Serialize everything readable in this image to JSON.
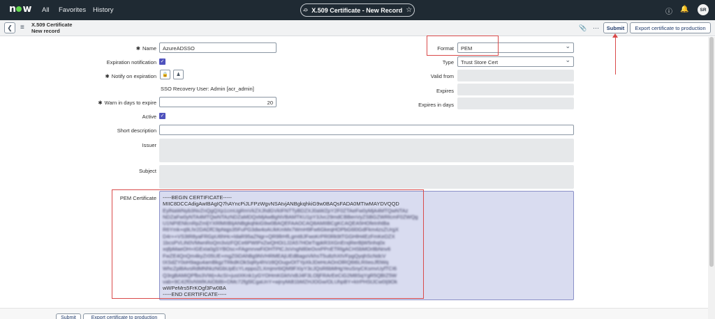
{
  "topnav": {
    "logo_left": "n",
    "logo_right": "w",
    "links": [
      "All",
      "Favorites",
      "History"
    ],
    "record_title": "X.509 Certificate - New Record",
    "star_icon": "star-icon",
    "help_icon": "help-icon",
    "bell_icon": "bell-icon",
    "avatar_initials": "SR"
  },
  "header": {
    "title": "X.509 Certificate",
    "subtitle": "New record",
    "submit_label": "Submit",
    "export_label": "Export certificate to production"
  },
  "form": {
    "name_label": "Name",
    "name_value": "AzureADSSO",
    "expiration_notification_label": "Expiration notification",
    "notify_label": "Notify on expiration",
    "notify_static": "SSO Recovery User: Admin [acr_admin]",
    "warn_label": "Warn in days to expire",
    "warn_value": "20",
    "active_label": "Active",
    "short_desc_label": "Short description",
    "short_desc_value": "",
    "issuer_label": "Issuer",
    "subject_label": "Subject",
    "pem_label": "PEM Certificate",
    "format_label": "Format",
    "format_value": "PEM",
    "type_label": "Type",
    "type_value": "Trust Store Cert",
    "valid_from_label": "Valid from",
    "expires_label": "Expires",
    "expires_in_days_label": "Expires in days",
    "pem_lines": [
      "-----BEGIN CERTIFICATE-----",
      "MIIC8DCCAdigAwIBAgIQ7hAYncPiJLFPzWgvNSAtvjANBgkqhkiG9w0BAQsFADA0MTIwMAYDVQQD",
      "EylNaWNyb3NvZnQgQXp1cmUgRmVkZXJhdGVkIFNTTyBDZXJ0aWZpY2F0ZTAeFw0yMjA4MTQwNTAz",
      "NDZaFw0yNTA4MTQwNTAzNDZaMDQxMjAwBgNVBAMTKU1pY3Jvc29mdCBBenVyZSBGZWRlcmF0ZWQg",
      "U1NPIENlcnRpZmljYXRlMIIBIjANBgkqhkiG9w0BAQEFAAOCAQ8AMIIBCgKCAQEA5HOfeInhtBa",
      "R6Ymk+q9Lhr2DADfC9pNqjs35FuPG3dw4oAUkKmMx7WmH9Fw6GkeqHOPbG6l0GdFkm4zsZUrgX",
      "D4r++VS3tR8yaFRGpU6hHc+ldaR95aZNgr+QR9llrHfLgmt8JFwoKrPR0Rk9tTGGHlH4EzFmKeDZX",
      "1bcsPVLiN0VMwnRoQm3vizFQCe6PWtPxZwQHOi1J2A57HOeTqpkR3XGnErxjRerBjW5nhq0x",
      "xqfpMaeOH+IGExIa0gSYBOsc+FAgmrvwFiOHTPtCJsVngNtl0eOvxPPnETRlgACHSbMOr8bNnv6",
      "FwZE4QnQm4kyZr05UE+mgZ0iDAhBg9NVHRMEAjUEdBagoVkhsT5u8zhXtVFpgQyqhScNdcV",
      "tXSdZY0oH9agu4amBkgzTRkdKOkSqRy4hVz8QOugvOtTYpXkJDeHcAOnOlRQ6t6LRIIeoJf0Wq",
      "WhcZpl8AvsRdMNhkzNGbUpEcYLeppoZLXmjmr6iQM9FXiyY3cJQsR6bMHgYeuSnyCKsmvUyfTCI6",
      "Q3rgBAMiQPfbs3VWj+AcSI+justXKnk1yGYOHmKGktVxBJ4F3LOljFRArEeCiG2M8SqYgR5QBIZ5W",
      "vab+9C42f0vNWlKAiObl8i+DMc72fg5lCgaUnY+wjnyMdt1bMZHJOGw/OLUhpBY+kIrPHStJCw0Ij9Ok",
      "wWPeMrs5FrKOgf3Fw0BA",
      "-----END CERTIFICATE-----"
    ]
  },
  "footer": {
    "submit_label": "Submit",
    "export_label": "Export certificate to production"
  }
}
